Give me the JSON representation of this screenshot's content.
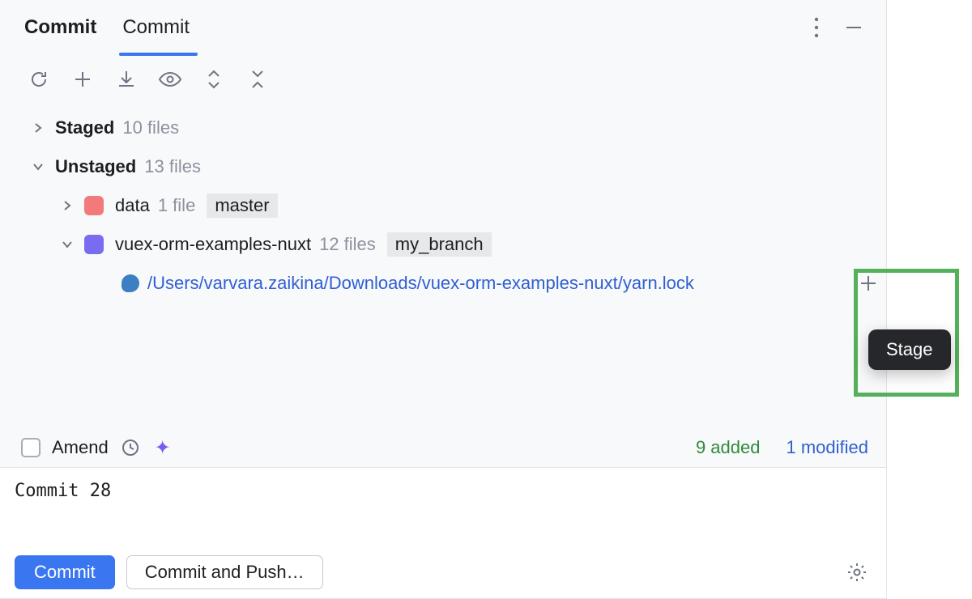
{
  "tabs": {
    "label_bold": "Commit",
    "label_underline": "Commit"
  },
  "toolbar": {
    "refresh": "refresh",
    "add": "add",
    "fetch": "fetch",
    "eye": "eye",
    "updown": "updown",
    "collapse": "collapse"
  },
  "tree": {
    "staged": {
      "label": "Staged",
      "count": "10 files"
    },
    "unstaged": {
      "label": "Unstaged",
      "count": "13 files"
    },
    "data_folder": {
      "name": "data",
      "count": "1 file",
      "branch": "master"
    },
    "vuex_folder": {
      "name": "vuex-orm-examples-nuxt",
      "count": "12 files",
      "branch": "my_branch"
    },
    "file_path": "/Users/varvara.zaikina/Downloads/vuex-orm-examples-nuxt/yarn.lock"
  },
  "tooltip": {
    "stage": "Stage"
  },
  "amend": {
    "label": "Amend",
    "added": "9 added",
    "modified": "1 modified"
  },
  "message": {
    "value": "Commit 28"
  },
  "footer": {
    "commit": "Commit",
    "commit_push": "Commit and Push…"
  }
}
